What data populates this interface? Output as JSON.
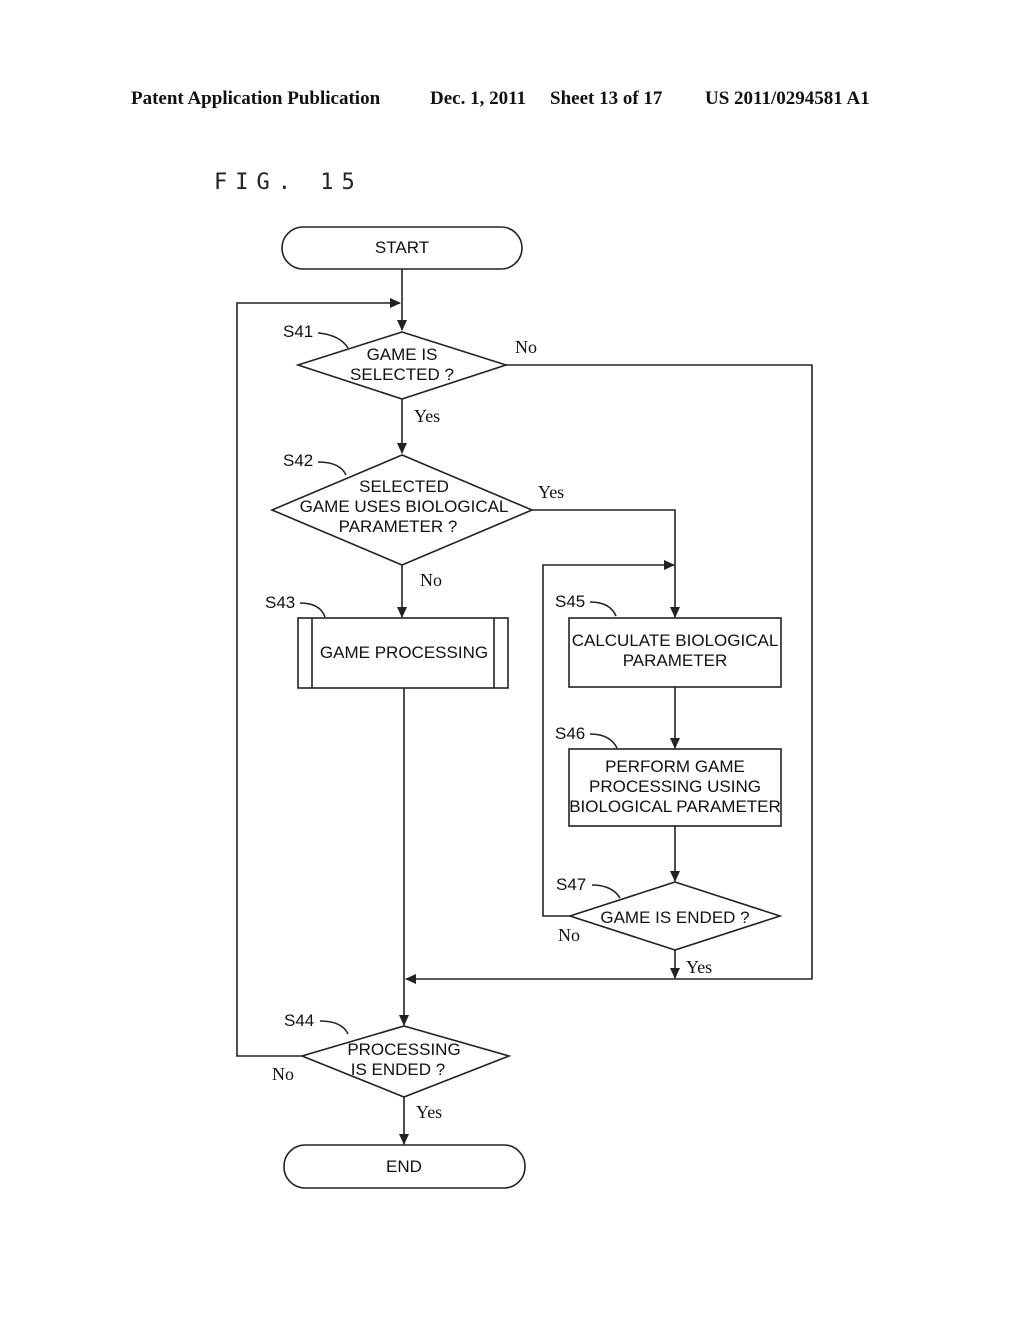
{
  "header": {
    "publication": "Patent Application Publication",
    "date": "Dec. 1, 2011",
    "sheet": "Sheet 13 of 17",
    "number": "US 2011/0294581 A1"
  },
  "figure": {
    "title": "FIG. 15"
  },
  "flowchart": {
    "start": "START",
    "end": "END",
    "steps": {
      "s41": {
        "id": "S41",
        "lines": [
          "GAME IS",
          "SELECTED ?"
        ]
      },
      "s42": {
        "id": "S42",
        "lines": [
          "SELECTED",
          "GAME USES BIOLOGICAL",
          "PARAMETER ?"
        ]
      },
      "s43": {
        "id": "S43",
        "lines": [
          "GAME PROCESSING"
        ]
      },
      "s44": {
        "id": "S44",
        "lines": [
          "PROCESSING",
          "IS ENDED ?"
        ]
      },
      "s45": {
        "id": "S45",
        "lines": [
          "CALCULATE BIOLOGICAL",
          "PARAMETER"
        ]
      },
      "s46": {
        "id": "S46",
        "lines": [
          "PERFORM GAME",
          "PROCESSING USING",
          "BIOLOGICAL PARAMETER"
        ]
      },
      "s47": {
        "id": "S47",
        "lines": [
          "GAME IS ENDED ?"
        ]
      }
    },
    "branch_labels": {
      "s41_yes": "Yes",
      "s41_no": "No",
      "s42_yes": "Yes",
      "s42_no": "No",
      "s47_yes": "Yes",
      "s47_no": "No",
      "s44_yes": "Yes",
      "s44_no": "No"
    }
  }
}
